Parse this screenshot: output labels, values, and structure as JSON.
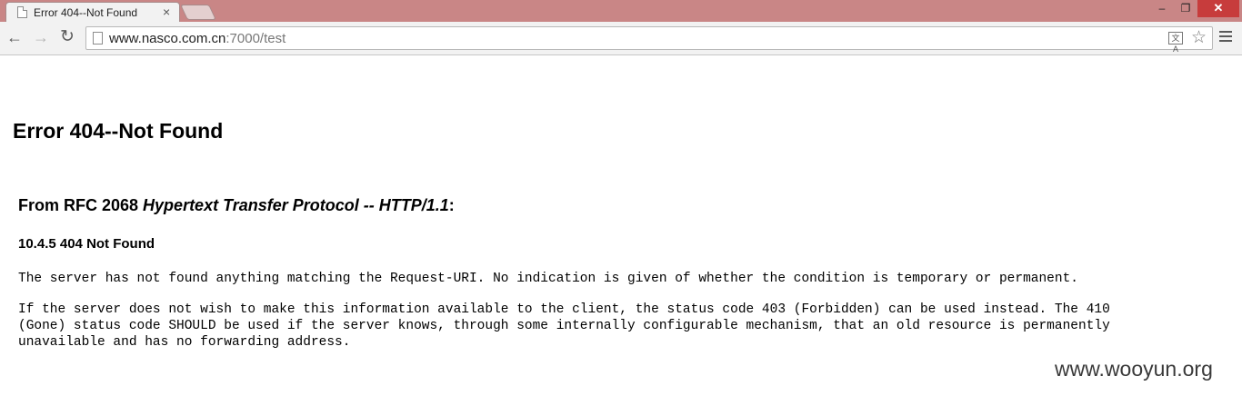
{
  "browser": {
    "tab_title": "Error 404--Not Found",
    "tab_close": "×",
    "url_host": "www.nasco.com.cn",
    "url_rest": ":7000/test",
    "window_minimize": "–",
    "window_maximize": "❐",
    "window_close": "✕",
    "nav_back": "←",
    "nav_forward": "→",
    "nav_reload": "↻",
    "star": "☆",
    "translate": "文A"
  },
  "page": {
    "heading": "Error 404--Not Found",
    "rfc_prefix": "From RFC 2068 ",
    "rfc_title": "Hypertext Transfer Protocol -- HTTP/1.1",
    "rfc_suffix": ":",
    "section": "10.4.5 404 Not Found",
    "paragraph1": "The server has not found anything matching the Request-URI. No indication is given of whether the condition is temporary or permanent.",
    "paragraph2_line1": "If the server does not wish to make this information available to the client, the status code 403 (Forbidden) can be used instead. The 410",
    "paragraph2_line2": "(Gone) status code SHOULD be used if the server knows, through some internally configurable mechanism, that an old resource is permanently",
    "paragraph2_line3": "unavailable and has no forwarding address."
  },
  "watermark": "www.wooyun.org",
  "colors": {
    "titlebar": "#c98686",
    "close_button": "#c73c3c",
    "toolbar": "#f2f2f2"
  }
}
